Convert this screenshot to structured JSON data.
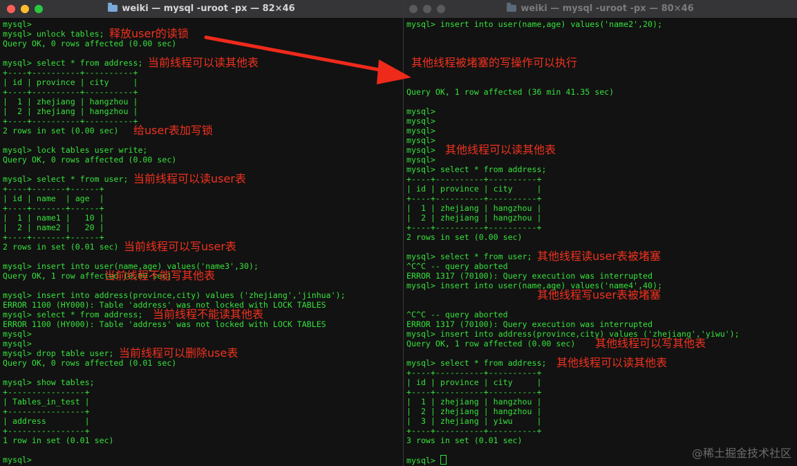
{
  "left_window": {
    "title": "weiki — mysql -uroot -px — 82×46",
    "lines": [
      "mysql>",
      "mysql> unlock tables;",
      "Query OK, 0 rows affected (0.00 sec)",
      "",
      "mysql> select * from address;",
      "+----+----------+----------+",
      "| id | province | city     |",
      "+----+----------+----------+",
      "|  1 | zhejiang | hangzhou |",
      "|  2 | zhejiang | hangzhou |",
      "+----+----------+----------+",
      "2 rows in set (0.00 sec)",
      "",
      "mysql> lock tables user write;",
      "Query OK, 0 rows affected (0.00 sec)",
      "",
      "mysql> select * from user;",
      "+----+-------+------+",
      "| id | name  | age  |",
      "+----+-------+------+",
      "|  1 | name1 |   10 |",
      "|  2 | name2 |   20 |",
      "+----+-------+------+",
      "2 rows in set (0.01 sec)",
      "",
      "mysql> insert into user(name,age) values('name3',30);",
      "Query OK, 1 row affected (0.00 sec)",
      "",
      "mysql> insert into address(province,city) values ('zhejiang','jinhua');",
      "ERROR 1100 (HY000): Table 'address' was not locked with LOCK TABLES",
      "mysql> select * from address;",
      "ERROR 1100 (HY000): Table 'address' was not locked with LOCK TABLES",
      "mysql>",
      "mysql>",
      "mysql> drop table user;",
      "Query OK, 0 rows affected (0.01 sec)",
      "",
      "mysql> show tables;",
      "+----------------+",
      "| Tables_in_test |",
      "+----------------+",
      "| address        |",
      "+----------------+",
      "1 row in set (0.01 sec)",
      "",
      "mysql>"
    ],
    "annotations": [
      {
        "text": "释放user的读锁",
        "row": 1,
        "col": 22
      },
      {
        "text": "当前线程可以读其他表",
        "row": 4,
        "col": 30
      },
      {
        "text": "给user表加写锁",
        "row": 11,
        "col": 27
      },
      {
        "text": "当前线程可以读user表",
        "row": 16,
        "col": 27
      },
      {
        "text": "当前线程可以写user表",
        "row": 23,
        "col": 25
      },
      {
        "text": "当前线程不能写其他表",
        "row": 26,
        "col": 21
      },
      {
        "text": "当前线程不能读其他表",
        "row": 30,
        "col": 31
      },
      {
        "text": "当前线程可以删除use表",
        "row": 34,
        "col": 24
      }
    ]
  },
  "right_window": {
    "title": "weiki — mysql -uroot -px — 80×46",
    "lines": [
      "mysql> insert into user(name,age) values('name2',20);",
      "",
      "",
      "",
      "",
      "",
      "",
      "Query OK, 1 row affected (36 min 41.35 sec)",
      "",
      "mysql>",
      "mysql>",
      "mysql>",
      "mysql>",
      "mysql>",
      "mysql>",
      "mysql> select * from address;",
      "+----+----------+----------+",
      "| id | province | city     |",
      "+----+----------+----------+",
      "|  1 | zhejiang | hangzhou |",
      "|  2 | zhejiang | hangzhou |",
      "+----+----------+----------+",
      "2 rows in set (0.00 sec)",
      "",
      "mysql> select * from user;",
      "^C^C -- query aborted",
      "ERROR 1317 (70100): Query execution was interrupted",
      "mysql> insert into user(name,age) values('name4',40);",
      "",
      "",
      "^C^C -- query aborted",
      "ERROR 1317 (70100): Query execution was interrupted",
      "mysql> insert into address(province,city) values ('zhejiang','yiwu');",
      "Query OK, 1 row affected (0.00 sec)",
      "",
      "mysql> select * from address;",
      "+----+----------+----------+",
      "| id | province | city     |",
      "+----+----------+----------+",
      "|  1 | zhejiang | hangzhou |",
      "|  2 | zhejiang | hangzhou |",
      "|  3 | zhejiang | yiwu     |",
      "+----+----------+----------+",
      "3 rows in set (0.01 sec)",
      "",
      "mysql> "
    ],
    "annotations": [
      {
        "text": "其他线程被堵塞的写操作可以执行",
        "row": 4,
        "col": 1
      },
      {
        "text": "其他线程可以读其他表",
        "row": 13,
        "col": 8
      },
      {
        "text": "其他线程读user表被堵塞",
        "row": 24,
        "col": 27
      },
      {
        "text": "其他线程写user表被堵塞",
        "row": 28,
        "col": 27
      },
      {
        "text": "其他线程可以写其他表",
        "row": 33,
        "col": 39
      },
      {
        "text": "其他线程可以读其他表",
        "row": 35,
        "col": 31
      }
    ]
  },
  "watermark": "@稀土掘金技术社区",
  "colors": {
    "terminal_text": "#36e23c",
    "annotation": "#f0321f",
    "terminal_bg": "#121212",
    "titlebar": "#353537",
    "close": "#fe5f57",
    "minimize": "#febc2e",
    "zoom": "#28c840"
  }
}
